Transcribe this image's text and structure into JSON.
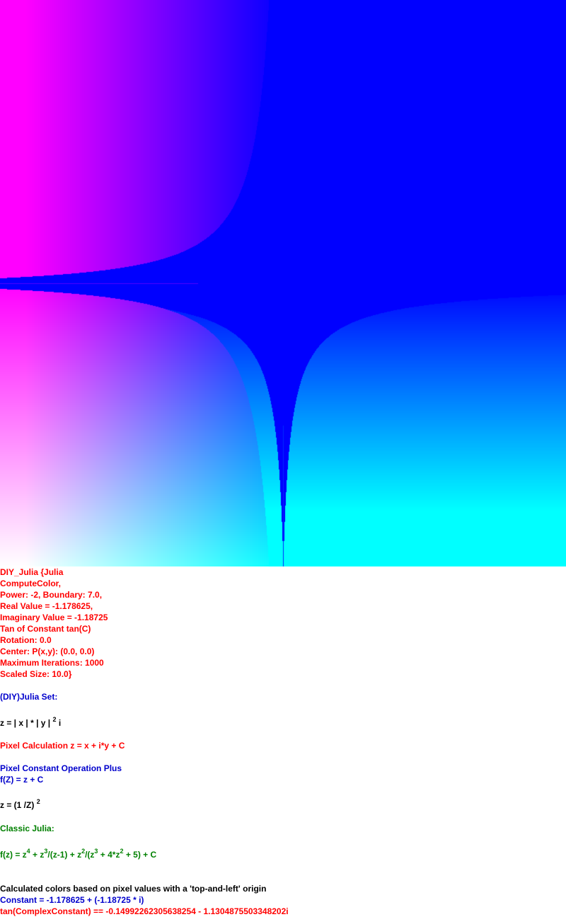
{
  "colors": {
    "red": "#ff0000",
    "blue": "#0000cc",
    "green": "#008000",
    "black": "#000000",
    "fractal_magenta": "#ff00ff",
    "fractal_blue": "#0000ff",
    "fractal_cyan": "#00ffff",
    "fractal_white": "#ffffff"
  },
  "params": {
    "l1": "DIY_Julia {Julia",
    "l2": "ComputeColor,",
    "l3": "Power: -2, Boundary: 7.0,",
    "l4": "Real Value = -1.178625,",
    "l5": "Imaginary Value = -1.18725",
    "l6": "Tan of Constant tan(C)",
    "l7": "Rotation: 0.0",
    "l8": "Center: P(x,y): (0.0, 0.0)",
    "l9": "Maximum Iterations: 1000",
    "l10": "Scaled Size: 10.0}"
  },
  "set_title": "(DIY)Julia Set:",
  "formula1": {
    "a": "z = | x | * | y |",
    "exp": "2",
    "b": " i"
  },
  "pixel_calc": "Pixel Calculation z = x + i*y + C",
  "op_title": "Pixel Constant Operation Plus",
  "op_formula": "f(Z) = z + C",
  "formula2": {
    "a": "z = (1 /Z)",
    "exp": "2"
  },
  "classic_title": "Classic Julia:",
  "classic": {
    "p1": "f(z) = z",
    "e1": "4",
    "p2": " + z",
    "e2": "3",
    "p3": "/(z-1) + z",
    "e3": "2",
    "p4": "/(z",
    "e4": "3",
    "p5": " + 4*z",
    "e5": "2",
    "p6": " + 5) + C"
  },
  "footer": {
    "colors_note": "Calculated colors based on pixel values with a 'top-and-left' origin",
    "constant": "Constant = -1.178625 + (-1.18725 * i)",
    "tan": "tan(ComplexConstant) == -0.14992262305638254 - 1.1304875503348202i"
  }
}
